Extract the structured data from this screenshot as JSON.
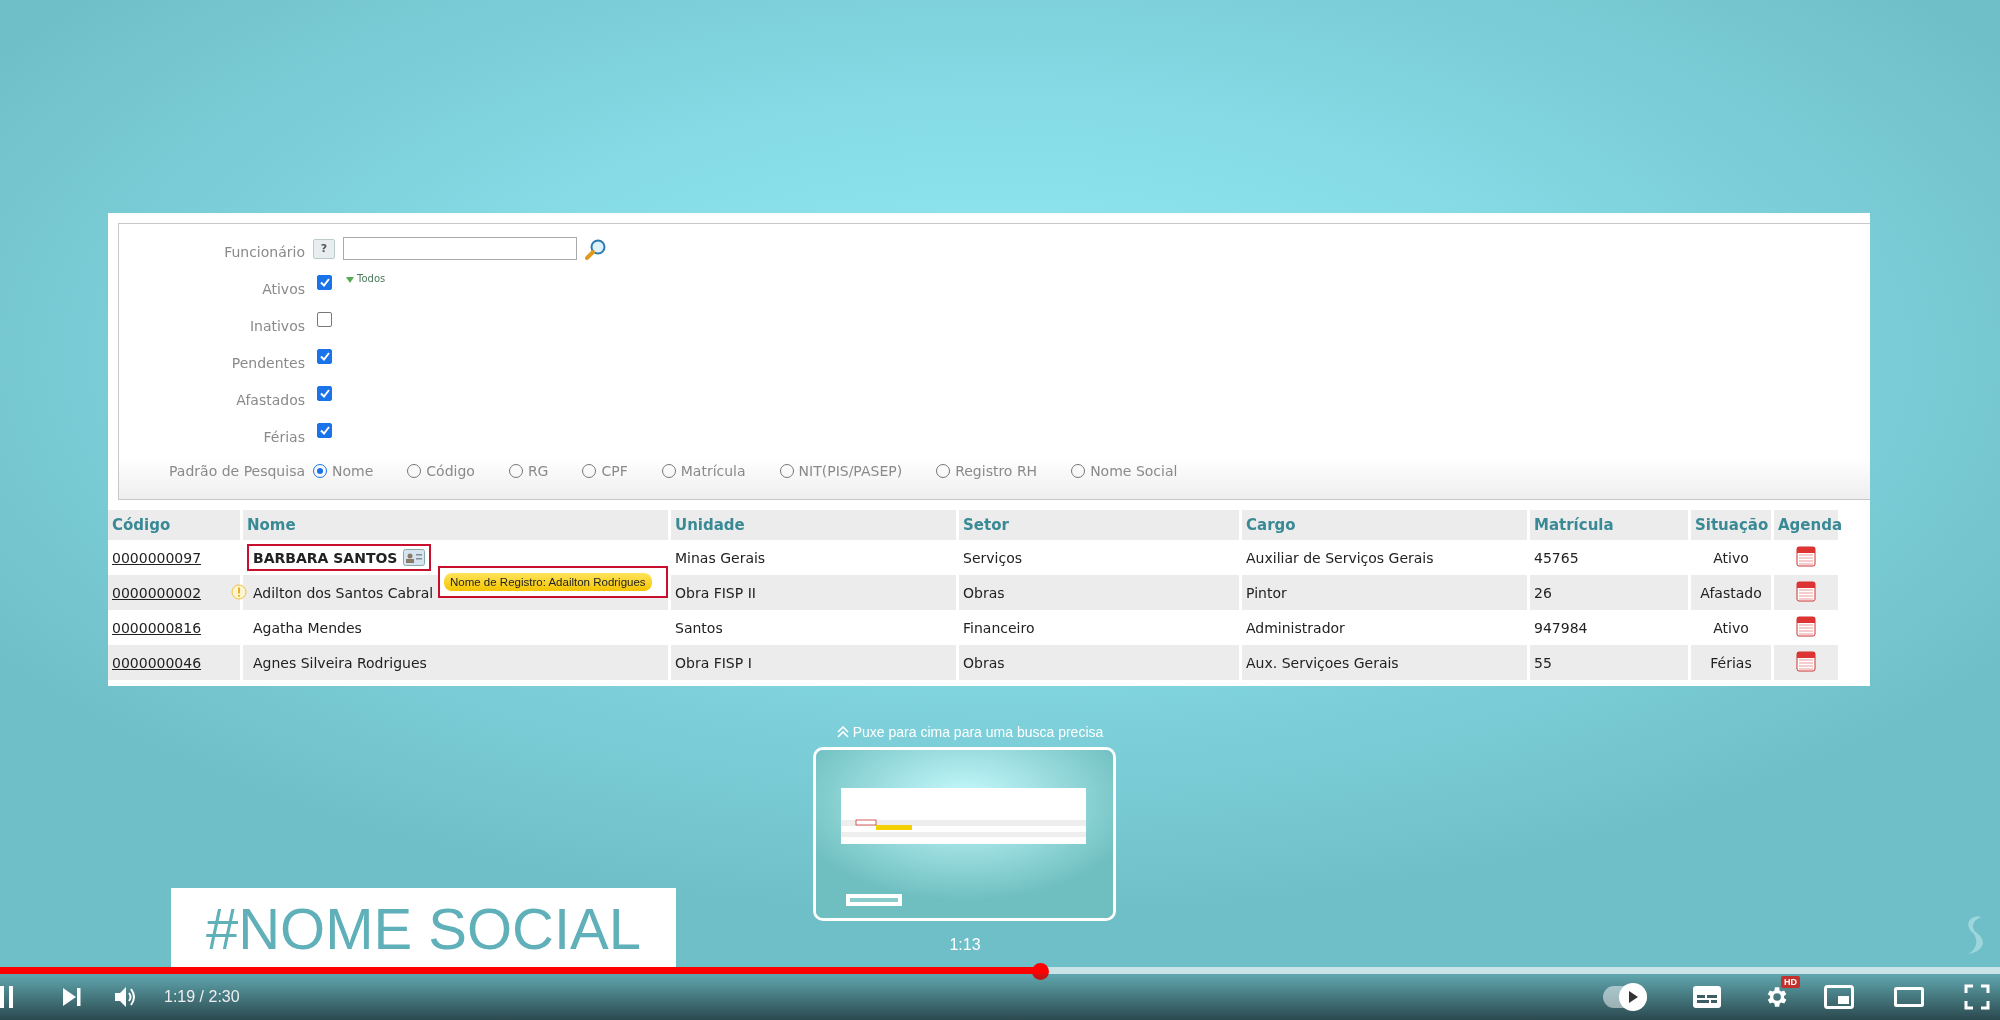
{
  "form": {
    "employee_label": "Funcionário",
    "help": "?",
    "all_link": "Todos",
    "filters": [
      {
        "label": "Ativos",
        "checked": true
      },
      {
        "label": "Inativos",
        "checked": false
      },
      {
        "label": "Pendentes",
        "checked": true
      },
      {
        "label": "Afastados",
        "checked": true
      },
      {
        "label": "Férias",
        "checked": true
      }
    ],
    "search_mode": {
      "label": "Padrão de Pesquisa",
      "options": [
        {
          "label": "Nome",
          "selected": true
        },
        {
          "label": "Código",
          "selected": false
        },
        {
          "label": "RG",
          "selected": false
        },
        {
          "label": "CPF",
          "selected": false
        },
        {
          "label": "Matrícula",
          "selected": false
        },
        {
          "label": "NIT(PIS/PASEP)",
          "selected": false
        },
        {
          "label": "Registro RH",
          "selected": false
        },
        {
          "label": "Nome Social",
          "selected": false
        }
      ]
    }
  },
  "table": {
    "columns": [
      "Código",
      "Nome",
      "Unidade",
      "Setor",
      "Cargo",
      "Matrícula",
      "Situação",
      "Agenda"
    ],
    "rows": [
      {
        "code": "0000000097",
        "name": "BARBARA SANTOS",
        "social_name": true,
        "warning": false,
        "unit": "Minas Gerais",
        "sector": "Serviços",
        "role": "Auxiliar de Serviços Gerais",
        "registration": "45765",
        "status": "Ativo"
      },
      {
        "code": "0000000002",
        "name": "Adilton dos Santos Cabral",
        "social_name": false,
        "warning": true,
        "unit": "Obra FISP II",
        "sector": "Obras",
        "role": "Pintor",
        "registration": "26",
        "status": "Afastado"
      },
      {
        "code": "0000000816",
        "name": "Agatha Mendes",
        "social_name": false,
        "warning": false,
        "unit": "Santos",
        "sector": "Financeiro",
        "role": "Administrador",
        "registration": "947984",
        "status": "Ativo"
      },
      {
        "code": "0000000046",
        "name": "Agnes Silveira Rodrigues",
        "social_name": false,
        "warning": false,
        "unit": "Obra FISP I",
        "sector": "Obras",
        "role": "Aux. Serviçoes Gerais",
        "registration": "55",
        "status": "Férias"
      }
    ],
    "tooltip": "Nome de Registro: Adailton Rodrigues"
  },
  "overlay_title": "#NOME SOCIAL",
  "preview": {
    "hint": "Puxe para cima para uma busca precisa",
    "time": "1:13"
  },
  "player": {
    "time": "1:19 / 2:30",
    "level": 0.52,
    "autoplay_on": true,
    "quality_badge": "HD"
  }
}
